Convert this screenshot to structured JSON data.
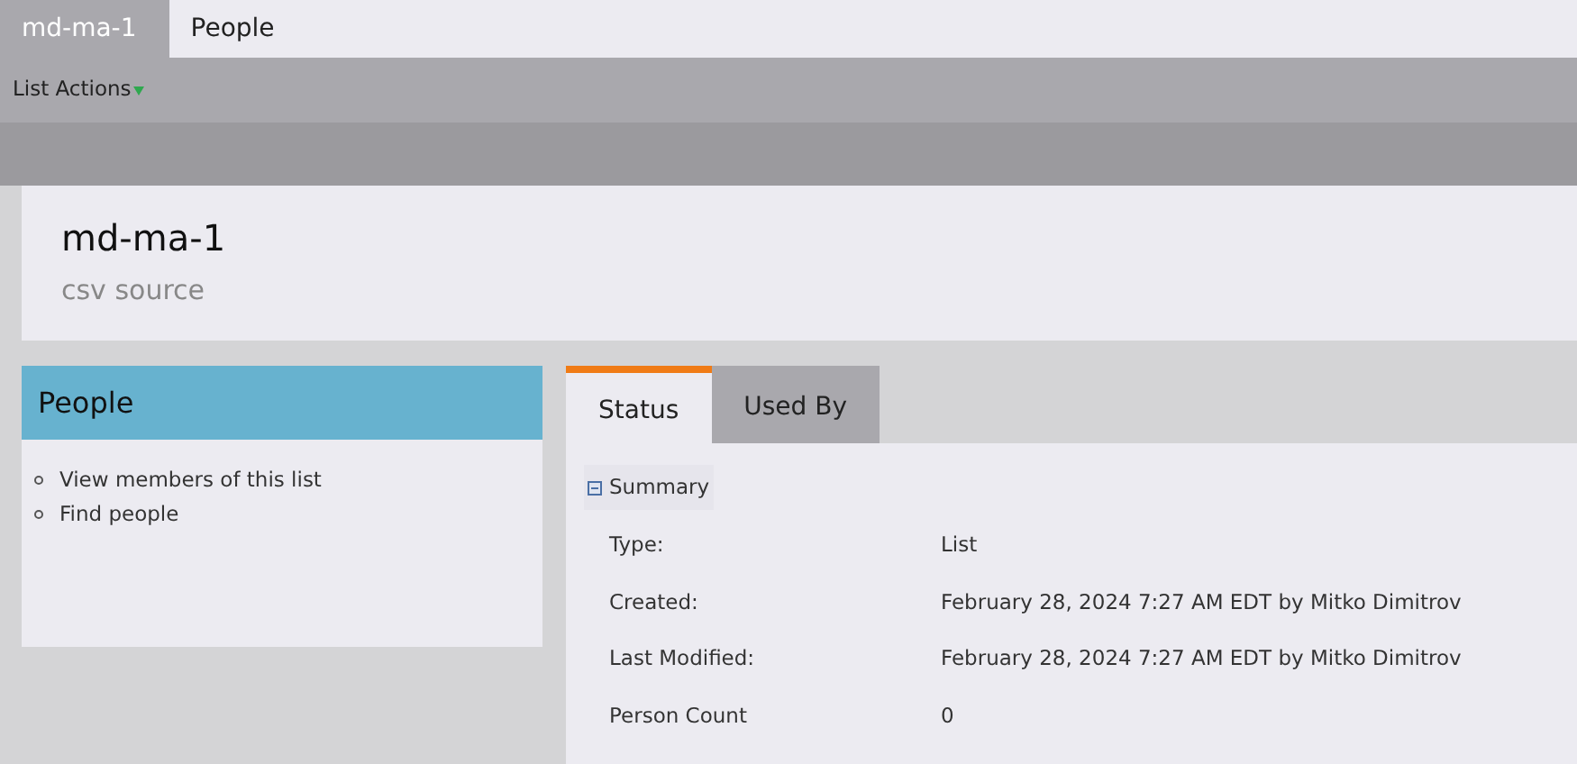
{
  "top_tabs": [
    {
      "label": "md-ma-1",
      "selected": true
    },
    {
      "label": "People",
      "selected": false
    }
  ],
  "toolbar": {
    "menu": "List Actions"
  },
  "header": {
    "title": "md-ma-1",
    "subtitle": "csv source"
  },
  "side_panel": {
    "title": "People",
    "links": [
      "View members of this list",
      "Find people"
    ]
  },
  "detail_tabs": [
    {
      "label": "Status",
      "selected": true
    },
    {
      "label": "Used By",
      "selected": false
    }
  ],
  "summary": {
    "title": "Summary",
    "expanded": true,
    "rows": [
      {
        "label": "Type:",
        "value": "List"
      },
      {
        "label": "Created:",
        "value": "February 28, 2024 7:27 AM EDT by Mitko Dimitrov"
      },
      {
        "label": "Last Modified:",
        "value": "February 28, 2024 7:27 AM EDT by Mitko Dimitrov"
      },
      {
        "label": "Person Count",
        "value": "0"
      }
    ]
  }
}
